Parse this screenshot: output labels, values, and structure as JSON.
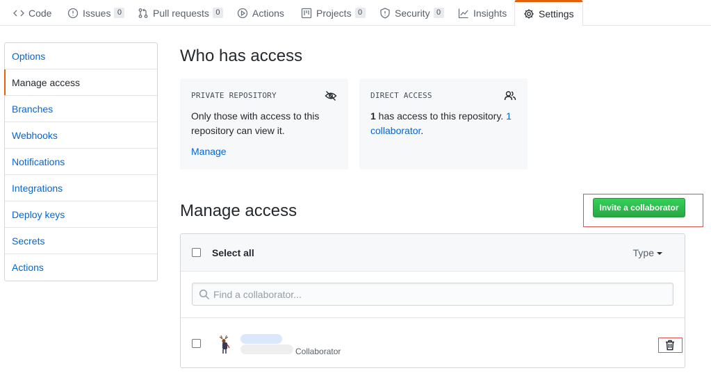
{
  "repo_nav": {
    "tabs": [
      {
        "label": "Code",
        "icon": "code-icon"
      },
      {
        "label": "Issues",
        "count": "0",
        "icon": "issue-icon"
      },
      {
        "label": "Pull requests",
        "count": "0",
        "icon": "pull-request-icon"
      },
      {
        "label": "Actions",
        "icon": "play-icon"
      },
      {
        "label": "Projects",
        "count": "0",
        "icon": "project-icon"
      },
      {
        "label": "Security",
        "count": "0",
        "icon": "shield-icon"
      },
      {
        "label": "Insights",
        "icon": "graph-icon"
      },
      {
        "label": "Settings",
        "icon": "gear-icon",
        "selected": true
      }
    ]
  },
  "sidebar": {
    "items": [
      {
        "label": "Options"
      },
      {
        "label": "Manage access",
        "active": true
      },
      {
        "label": "Branches"
      },
      {
        "label": "Webhooks"
      },
      {
        "label": "Notifications"
      },
      {
        "label": "Integrations"
      },
      {
        "label": "Deploy keys"
      },
      {
        "label": "Secrets"
      },
      {
        "label": "Actions"
      }
    ]
  },
  "who_has_access": {
    "title": "Who has access",
    "private_card": {
      "caption": "PRIVATE REPOSITORY",
      "text": "Only those with access to this repository can view it.",
      "link": "Manage",
      "icon": "eye-closed-icon"
    },
    "direct_card": {
      "caption": "DIRECT ACCESS",
      "count": "1",
      "text": " has access to this repository. ",
      "link": "1 collaborator",
      "suffix": ".",
      "icon": "people-icon"
    }
  },
  "manage_access": {
    "title": "Manage access",
    "invite_label": "Invite a collaborator",
    "select_all_label": "Select all",
    "type_label": "Type",
    "search_placeholder": "Find a collaborator...",
    "members": [
      {
        "role": "Collaborator",
        "avatar": "deer-avatar"
      }
    ]
  },
  "colors": {
    "accent_orange": "#e36209",
    "link_blue": "#0366d6",
    "button_green": "#28a745",
    "highlight_red": "#d9534f"
  }
}
